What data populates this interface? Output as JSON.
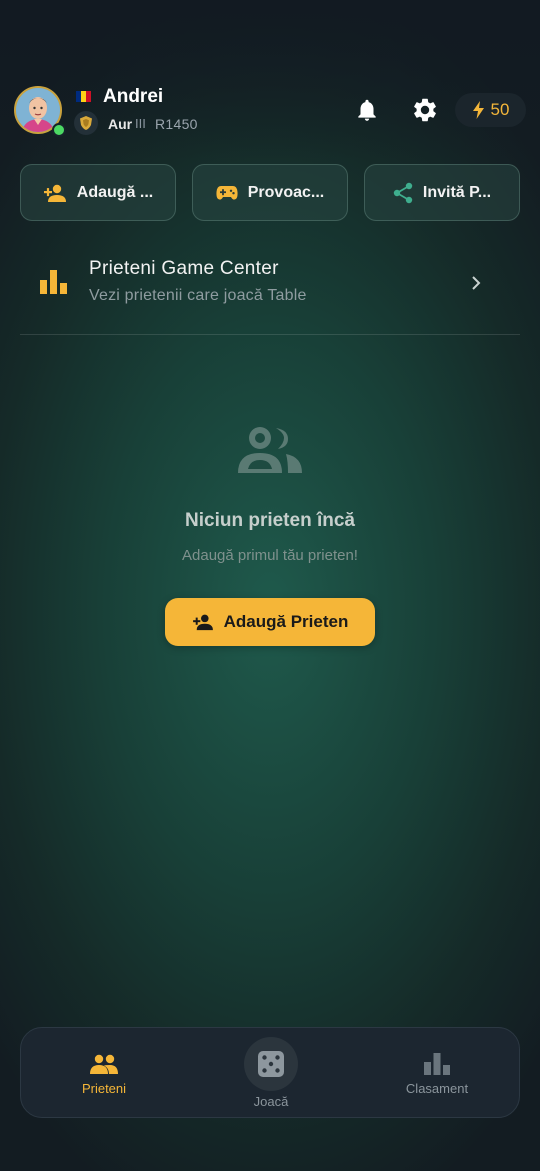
{
  "header": {
    "username": "Andrei",
    "rank_name": "Aur",
    "rank_division": "III",
    "rating": "R1450",
    "energy": "50"
  },
  "actions": [
    {
      "label": "Adaugă ...",
      "icon": "person-add-icon"
    },
    {
      "label": "Provoac...",
      "icon": "gamepad-icon"
    },
    {
      "label": "Invită P...",
      "icon": "share-icon"
    }
  ],
  "game_center": {
    "title": "Prieteni Game Center",
    "subtitle": "Vezi prietenii care joacă Table"
  },
  "empty_state": {
    "title": "Niciun prieten încă",
    "subtitle": "Adaugă primul tău prieten!",
    "button_label": "Adaugă Prieten"
  },
  "nav": {
    "items": [
      {
        "label": "Prieteni",
        "icon": "people-icon",
        "active": true
      },
      {
        "label": "Joacă",
        "icon": "dice-icon",
        "active": false
      },
      {
        "label": "Clasament",
        "icon": "bar-chart-icon",
        "active": false
      }
    ]
  },
  "colors": {
    "accent": "#f5b638",
    "teal_icon": "#3fae8e",
    "online": "#4cd964"
  }
}
